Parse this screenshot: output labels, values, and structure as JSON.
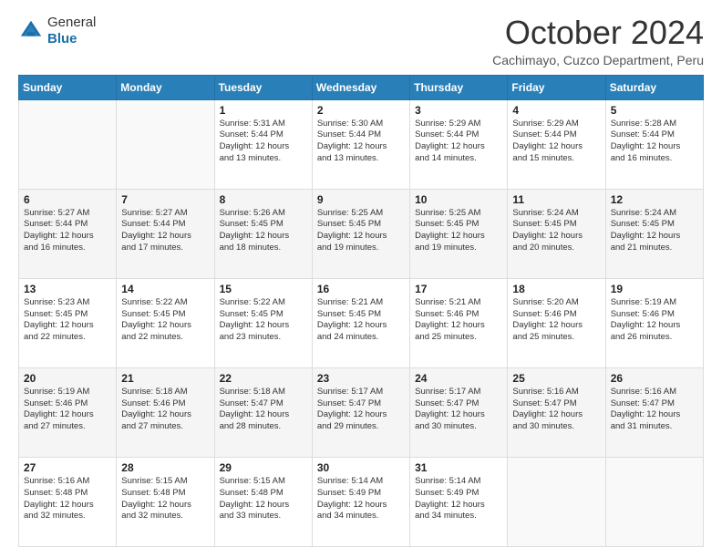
{
  "logo": {
    "general": "General",
    "blue": "Blue"
  },
  "title": "October 2024",
  "subtitle": "Cachimayo, Cuzco Department, Peru",
  "days": [
    "Sunday",
    "Monday",
    "Tuesday",
    "Wednesday",
    "Thursday",
    "Friday",
    "Saturday"
  ],
  "weeks": [
    [
      {
        "num": "",
        "lines": []
      },
      {
        "num": "",
        "lines": []
      },
      {
        "num": "1",
        "lines": [
          "Sunrise: 5:31 AM",
          "Sunset: 5:44 PM",
          "Daylight: 12 hours",
          "and 13 minutes."
        ]
      },
      {
        "num": "2",
        "lines": [
          "Sunrise: 5:30 AM",
          "Sunset: 5:44 PM",
          "Daylight: 12 hours",
          "and 13 minutes."
        ]
      },
      {
        "num": "3",
        "lines": [
          "Sunrise: 5:29 AM",
          "Sunset: 5:44 PM",
          "Daylight: 12 hours",
          "and 14 minutes."
        ]
      },
      {
        "num": "4",
        "lines": [
          "Sunrise: 5:29 AM",
          "Sunset: 5:44 PM",
          "Daylight: 12 hours",
          "and 15 minutes."
        ]
      },
      {
        "num": "5",
        "lines": [
          "Sunrise: 5:28 AM",
          "Sunset: 5:44 PM",
          "Daylight: 12 hours",
          "and 16 minutes."
        ]
      }
    ],
    [
      {
        "num": "6",
        "lines": [
          "Sunrise: 5:27 AM",
          "Sunset: 5:44 PM",
          "Daylight: 12 hours",
          "and 16 minutes."
        ]
      },
      {
        "num": "7",
        "lines": [
          "Sunrise: 5:27 AM",
          "Sunset: 5:44 PM",
          "Daylight: 12 hours",
          "and 17 minutes."
        ]
      },
      {
        "num": "8",
        "lines": [
          "Sunrise: 5:26 AM",
          "Sunset: 5:45 PM",
          "Daylight: 12 hours",
          "and 18 minutes."
        ]
      },
      {
        "num": "9",
        "lines": [
          "Sunrise: 5:25 AM",
          "Sunset: 5:45 PM",
          "Daylight: 12 hours",
          "and 19 minutes."
        ]
      },
      {
        "num": "10",
        "lines": [
          "Sunrise: 5:25 AM",
          "Sunset: 5:45 PM",
          "Daylight: 12 hours",
          "and 19 minutes."
        ]
      },
      {
        "num": "11",
        "lines": [
          "Sunrise: 5:24 AM",
          "Sunset: 5:45 PM",
          "Daylight: 12 hours",
          "and 20 minutes."
        ]
      },
      {
        "num": "12",
        "lines": [
          "Sunrise: 5:24 AM",
          "Sunset: 5:45 PM",
          "Daylight: 12 hours",
          "and 21 minutes."
        ]
      }
    ],
    [
      {
        "num": "13",
        "lines": [
          "Sunrise: 5:23 AM",
          "Sunset: 5:45 PM",
          "Daylight: 12 hours",
          "and 22 minutes."
        ]
      },
      {
        "num": "14",
        "lines": [
          "Sunrise: 5:22 AM",
          "Sunset: 5:45 PM",
          "Daylight: 12 hours",
          "and 22 minutes."
        ]
      },
      {
        "num": "15",
        "lines": [
          "Sunrise: 5:22 AM",
          "Sunset: 5:45 PM",
          "Daylight: 12 hours",
          "and 23 minutes."
        ]
      },
      {
        "num": "16",
        "lines": [
          "Sunrise: 5:21 AM",
          "Sunset: 5:45 PM",
          "Daylight: 12 hours",
          "and 24 minutes."
        ]
      },
      {
        "num": "17",
        "lines": [
          "Sunrise: 5:21 AM",
          "Sunset: 5:46 PM",
          "Daylight: 12 hours",
          "and 25 minutes."
        ]
      },
      {
        "num": "18",
        "lines": [
          "Sunrise: 5:20 AM",
          "Sunset: 5:46 PM",
          "Daylight: 12 hours",
          "and 25 minutes."
        ]
      },
      {
        "num": "19",
        "lines": [
          "Sunrise: 5:19 AM",
          "Sunset: 5:46 PM",
          "Daylight: 12 hours",
          "and 26 minutes."
        ]
      }
    ],
    [
      {
        "num": "20",
        "lines": [
          "Sunrise: 5:19 AM",
          "Sunset: 5:46 PM",
          "Daylight: 12 hours",
          "and 27 minutes."
        ]
      },
      {
        "num": "21",
        "lines": [
          "Sunrise: 5:18 AM",
          "Sunset: 5:46 PM",
          "Daylight: 12 hours",
          "and 27 minutes."
        ]
      },
      {
        "num": "22",
        "lines": [
          "Sunrise: 5:18 AM",
          "Sunset: 5:47 PM",
          "Daylight: 12 hours",
          "and 28 minutes."
        ]
      },
      {
        "num": "23",
        "lines": [
          "Sunrise: 5:17 AM",
          "Sunset: 5:47 PM",
          "Daylight: 12 hours",
          "and 29 minutes."
        ]
      },
      {
        "num": "24",
        "lines": [
          "Sunrise: 5:17 AM",
          "Sunset: 5:47 PM",
          "Daylight: 12 hours",
          "and 30 minutes."
        ]
      },
      {
        "num": "25",
        "lines": [
          "Sunrise: 5:16 AM",
          "Sunset: 5:47 PM",
          "Daylight: 12 hours",
          "and 30 minutes."
        ]
      },
      {
        "num": "26",
        "lines": [
          "Sunrise: 5:16 AM",
          "Sunset: 5:47 PM",
          "Daylight: 12 hours",
          "and 31 minutes."
        ]
      }
    ],
    [
      {
        "num": "27",
        "lines": [
          "Sunrise: 5:16 AM",
          "Sunset: 5:48 PM",
          "Daylight: 12 hours",
          "and 32 minutes."
        ]
      },
      {
        "num": "28",
        "lines": [
          "Sunrise: 5:15 AM",
          "Sunset: 5:48 PM",
          "Daylight: 12 hours",
          "and 32 minutes."
        ]
      },
      {
        "num": "29",
        "lines": [
          "Sunrise: 5:15 AM",
          "Sunset: 5:48 PM",
          "Daylight: 12 hours",
          "and 33 minutes."
        ]
      },
      {
        "num": "30",
        "lines": [
          "Sunrise: 5:14 AM",
          "Sunset: 5:49 PM",
          "Daylight: 12 hours",
          "and 34 minutes."
        ]
      },
      {
        "num": "31",
        "lines": [
          "Sunrise: 5:14 AM",
          "Sunset: 5:49 PM",
          "Daylight: 12 hours",
          "and 34 minutes."
        ]
      },
      {
        "num": "",
        "lines": []
      },
      {
        "num": "",
        "lines": []
      }
    ]
  ]
}
